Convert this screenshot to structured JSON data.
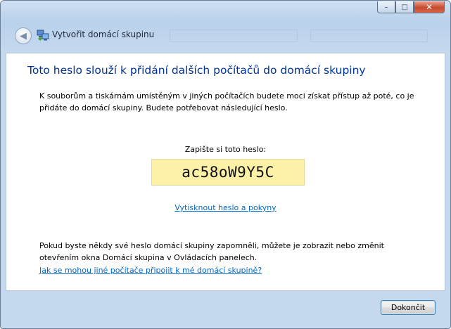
{
  "window": {
    "title": "Vytvořit domácí skupinu",
    "controls": {
      "minimize": "–",
      "maximize": "□",
      "close": "✕"
    }
  },
  "navigation": {
    "back_icon": "back-arrow-icon",
    "back_glyph": "◀"
  },
  "content": {
    "heading": "Toto heslo slouží k přidání dalších počítačů do domácí skupiny",
    "intro": "K souborům a tiskárnám umístěným v jiných počítačích budete moci získat přístup až poté, co je přidáte do domácí skupiny. Budete potřebovat následující heslo.",
    "password_label": "Zapište si toto heslo:",
    "password": "ac58oW9Y5C",
    "print_link": "Vytisknout heslo a pokyny",
    "forgot_text": "Pokud byste někdy své heslo domácí skupiny zapomněli, můžete je zobrazit nebo změnit otevřením okna Domácí skupina v Ovládacích panelech.",
    "help_link": "Jak se mohou jiné počítače připojit k mé domácí skupině?"
  },
  "footer": {
    "finish_label": "Dokončit"
  },
  "colors": {
    "heading": "#003399",
    "link": "#0066cc",
    "password_bg": "#fdf1a7",
    "button_border": "#3c7fb1"
  }
}
